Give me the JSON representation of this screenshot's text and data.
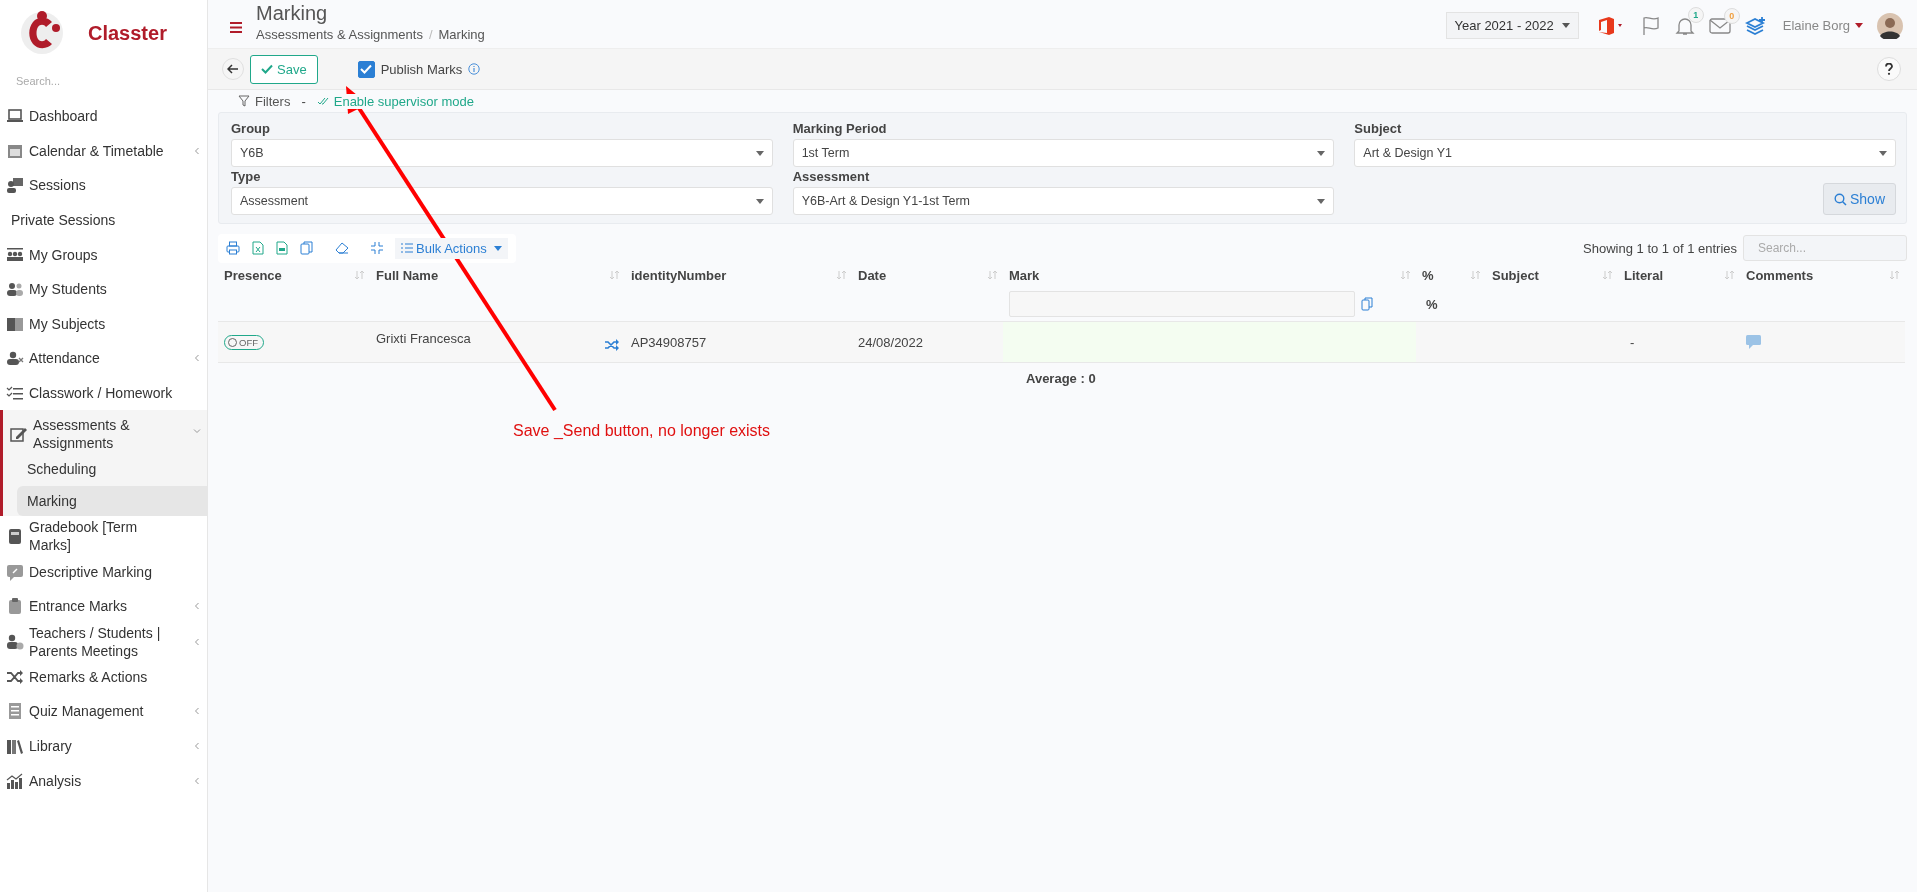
{
  "brand": {
    "name": "Classter"
  },
  "sidebar": {
    "search": {
      "placeholder": "Search..."
    },
    "items": [
      {
        "label": "Dashboard",
        "has_submenu": false,
        "expanded": false
      },
      {
        "label": "Calendar & Timetable",
        "has_submenu": true,
        "expanded": false
      },
      {
        "label": "Sessions",
        "has_submenu": false,
        "expanded": false
      },
      {
        "label": "Private Sessions",
        "has_submenu": false,
        "expanded": false
      },
      {
        "label": "My Groups",
        "has_submenu": false,
        "expanded": false
      },
      {
        "label": "My Students",
        "has_submenu": false,
        "expanded": false
      },
      {
        "label": "My Subjects",
        "has_submenu": false,
        "expanded": false
      },
      {
        "label": "Attendance",
        "has_submenu": true,
        "expanded": false
      },
      {
        "label": "Classwork / Homework",
        "has_submenu": false,
        "expanded": false
      },
      {
        "label": "Assessments & Assignments",
        "has_submenu": true,
        "expanded": true,
        "children": [
          {
            "label": "Scheduling",
            "selected": false
          },
          {
            "label": "Marking",
            "selected": true
          }
        ]
      },
      {
        "label": "Gradebook [Term Marks]",
        "has_submenu": false,
        "expanded": false
      },
      {
        "label": "Descriptive Marking",
        "has_submenu": false,
        "expanded": false
      },
      {
        "label": "Entrance Marks",
        "has_submenu": true,
        "expanded": false
      },
      {
        "label": "Teachers / Students | Parents Meetings",
        "has_submenu": true,
        "expanded": false
      },
      {
        "label": "Remarks & Actions",
        "has_submenu": false,
        "expanded": false
      },
      {
        "label": "Quiz Management",
        "has_submenu": true,
        "expanded": false
      },
      {
        "label": "Library",
        "has_submenu": true,
        "expanded": false
      },
      {
        "label": "Analysis",
        "has_submenu": true,
        "expanded": false
      }
    ]
  },
  "header": {
    "title": "Marking",
    "breadcrumb": [
      "Assessments & Assignments",
      "Marking"
    ],
    "breadcrumb_separator": "/",
    "year": "Year 2021 - 2022",
    "notifications": "1",
    "messages": "0",
    "user": "Elaine Borg"
  },
  "toolbar": {
    "save": "Save",
    "publish": {
      "label": "Publish Marks",
      "checked": true
    }
  },
  "filters": {
    "title": "Filters",
    "separator": "-",
    "supervisor": "Enable supervisor mode",
    "fields": [
      {
        "label": "Group",
        "value": "Y6B"
      },
      {
        "label": "Marking Period",
        "value": "1st Term"
      },
      {
        "label": "Subject",
        "value": "Art & Design Y1"
      },
      {
        "label": "Type",
        "value": "Assessment"
      },
      {
        "label": "Assessment",
        "value": "Y6B-Art & Design Y1-1st Term"
      }
    ],
    "show": "Show"
  },
  "table": {
    "bulk_actions": "Bulk Actions",
    "info": "Showing 1 to 1 of 1 entries",
    "search": {
      "placeholder": "Search..."
    },
    "columns": [
      "Presence",
      "Full Name",
      "identityNumber",
      "Date",
      "Mark",
      "%",
      "Subject",
      "Literal",
      "Comments"
    ],
    "percent_sub": "%",
    "rows": [
      {
        "presence": {
          "label": "OFF",
          "on": false
        },
        "name": "Grixti Francesca",
        "id": "AP34908757",
        "date": "24/08/2022",
        "literal": "-"
      }
    ],
    "average": "Average : 0"
  },
  "annotation": {
    "text": "Save _Send button, no longer exists"
  }
}
